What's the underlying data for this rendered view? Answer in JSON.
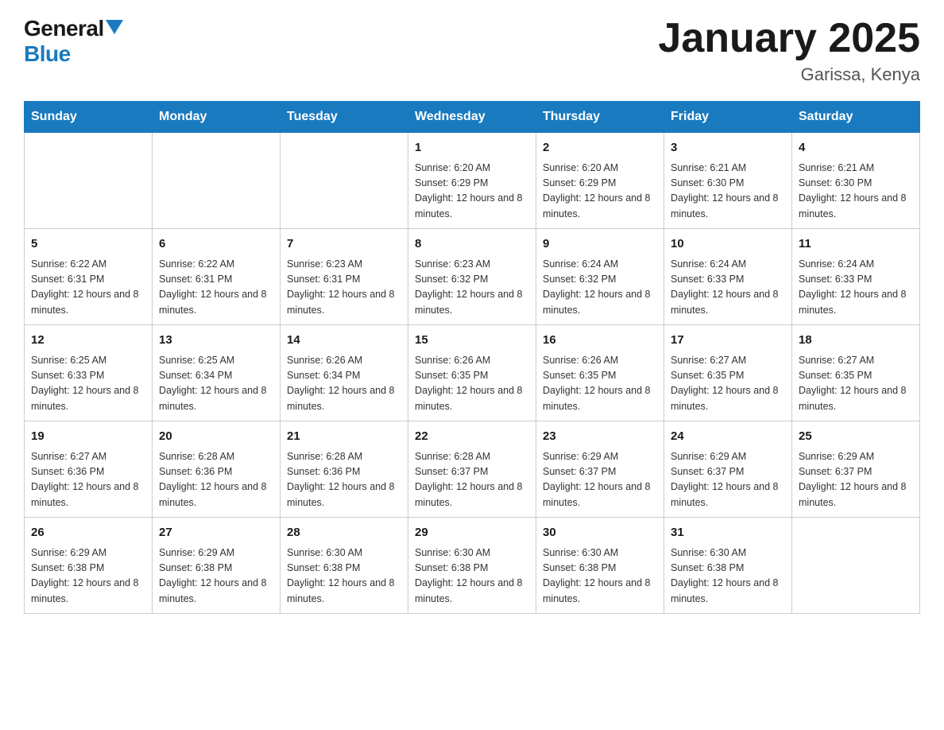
{
  "logo": {
    "general": "General",
    "blue": "Blue"
  },
  "title": {
    "month_year": "January 2025",
    "location": "Garissa, Kenya"
  },
  "weekdays": [
    "Sunday",
    "Monday",
    "Tuesday",
    "Wednesday",
    "Thursday",
    "Friday",
    "Saturday"
  ],
  "weeks": [
    [
      {
        "day": "",
        "info": ""
      },
      {
        "day": "",
        "info": ""
      },
      {
        "day": "",
        "info": ""
      },
      {
        "day": "1",
        "info": "Sunrise: 6:20 AM\nSunset: 6:29 PM\nDaylight: 12 hours and 8 minutes."
      },
      {
        "day": "2",
        "info": "Sunrise: 6:20 AM\nSunset: 6:29 PM\nDaylight: 12 hours and 8 minutes."
      },
      {
        "day": "3",
        "info": "Sunrise: 6:21 AM\nSunset: 6:30 PM\nDaylight: 12 hours and 8 minutes."
      },
      {
        "day": "4",
        "info": "Sunrise: 6:21 AM\nSunset: 6:30 PM\nDaylight: 12 hours and 8 minutes."
      }
    ],
    [
      {
        "day": "5",
        "info": "Sunrise: 6:22 AM\nSunset: 6:31 PM\nDaylight: 12 hours and 8 minutes."
      },
      {
        "day": "6",
        "info": "Sunrise: 6:22 AM\nSunset: 6:31 PM\nDaylight: 12 hours and 8 minutes."
      },
      {
        "day": "7",
        "info": "Sunrise: 6:23 AM\nSunset: 6:31 PM\nDaylight: 12 hours and 8 minutes."
      },
      {
        "day": "8",
        "info": "Sunrise: 6:23 AM\nSunset: 6:32 PM\nDaylight: 12 hours and 8 minutes."
      },
      {
        "day": "9",
        "info": "Sunrise: 6:24 AM\nSunset: 6:32 PM\nDaylight: 12 hours and 8 minutes."
      },
      {
        "day": "10",
        "info": "Sunrise: 6:24 AM\nSunset: 6:33 PM\nDaylight: 12 hours and 8 minutes."
      },
      {
        "day": "11",
        "info": "Sunrise: 6:24 AM\nSunset: 6:33 PM\nDaylight: 12 hours and 8 minutes."
      }
    ],
    [
      {
        "day": "12",
        "info": "Sunrise: 6:25 AM\nSunset: 6:33 PM\nDaylight: 12 hours and 8 minutes."
      },
      {
        "day": "13",
        "info": "Sunrise: 6:25 AM\nSunset: 6:34 PM\nDaylight: 12 hours and 8 minutes."
      },
      {
        "day": "14",
        "info": "Sunrise: 6:26 AM\nSunset: 6:34 PM\nDaylight: 12 hours and 8 minutes."
      },
      {
        "day": "15",
        "info": "Sunrise: 6:26 AM\nSunset: 6:35 PM\nDaylight: 12 hours and 8 minutes."
      },
      {
        "day": "16",
        "info": "Sunrise: 6:26 AM\nSunset: 6:35 PM\nDaylight: 12 hours and 8 minutes."
      },
      {
        "day": "17",
        "info": "Sunrise: 6:27 AM\nSunset: 6:35 PM\nDaylight: 12 hours and 8 minutes."
      },
      {
        "day": "18",
        "info": "Sunrise: 6:27 AM\nSunset: 6:35 PM\nDaylight: 12 hours and 8 minutes."
      }
    ],
    [
      {
        "day": "19",
        "info": "Sunrise: 6:27 AM\nSunset: 6:36 PM\nDaylight: 12 hours and 8 minutes."
      },
      {
        "day": "20",
        "info": "Sunrise: 6:28 AM\nSunset: 6:36 PM\nDaylight: 12 hours and 8 minutes."
      },
      {
        "day": "21",
        "info": "Sunrise: 6:28 AM\nSunset: 6:36 PM\nDaylight: 12 hours and 8 minutes."
      },
      {
        "day": "22",
        "info": "Sunrise: 6:28 AM\nSunset: 6:37 PM\nDaylight: 12 hours and 8 minutes."
      },
      {
        "day": "23",
        "info": "Sunrise: 6:29 AM\nSunset: 6:37 PM\nDaylight: 12 hours and 8 minutes."
      },
      {
        "day": "24",
        "info": "Sunrise: 6:29 AM\nSunset: 6:37 PM\nDaylight: 12 hours and 8 minutes."
      },
      {
        "day": "25",
        "info": "Sunrise: 6:29 AM\nSunset: 6:37 PM\nDaylight: 12 hours and 8 minutes."
      }
    ],
    [
      {
        "day": "26",
        "info": "Sunrise: 6:29 AM\nSunset: 6:38 PM\nDaylight: 12 hours and 8 minutes."
      },
      {
        "day": "27",
        "info": "Sunrise: 6:29 AM\nSunset: 6:38 PM\nDaylight: 12 hours and 8 minutes."
      },
      {
        "day": "28",
        "info": "Sunrise: 6:30 AM\nSunset: 6:38 PM\nDaylight: 12 hours and 8 minutes."
      },
      {
        "day": "29",
        "info": "Sunrise: 6:30 AM\nSunset: 6:38 PM\nDaylight: 12 hours and 8 minutes."
      },
      {
        "day": "30",
        "info": "Sunrise: 6:30 AM\nSunset: 6:38 PM\nDaylight: 12 hours and 8 minutes."
      },
      {
        "day": "31",
        "info": "Sunrise: 6:30 AM\nSunset: 6:38 PM\nDaylight: 12 hours and 8 minutes."
      },
      {
        "day": "",
        "info": ""
      }
    ]
  ]
}
